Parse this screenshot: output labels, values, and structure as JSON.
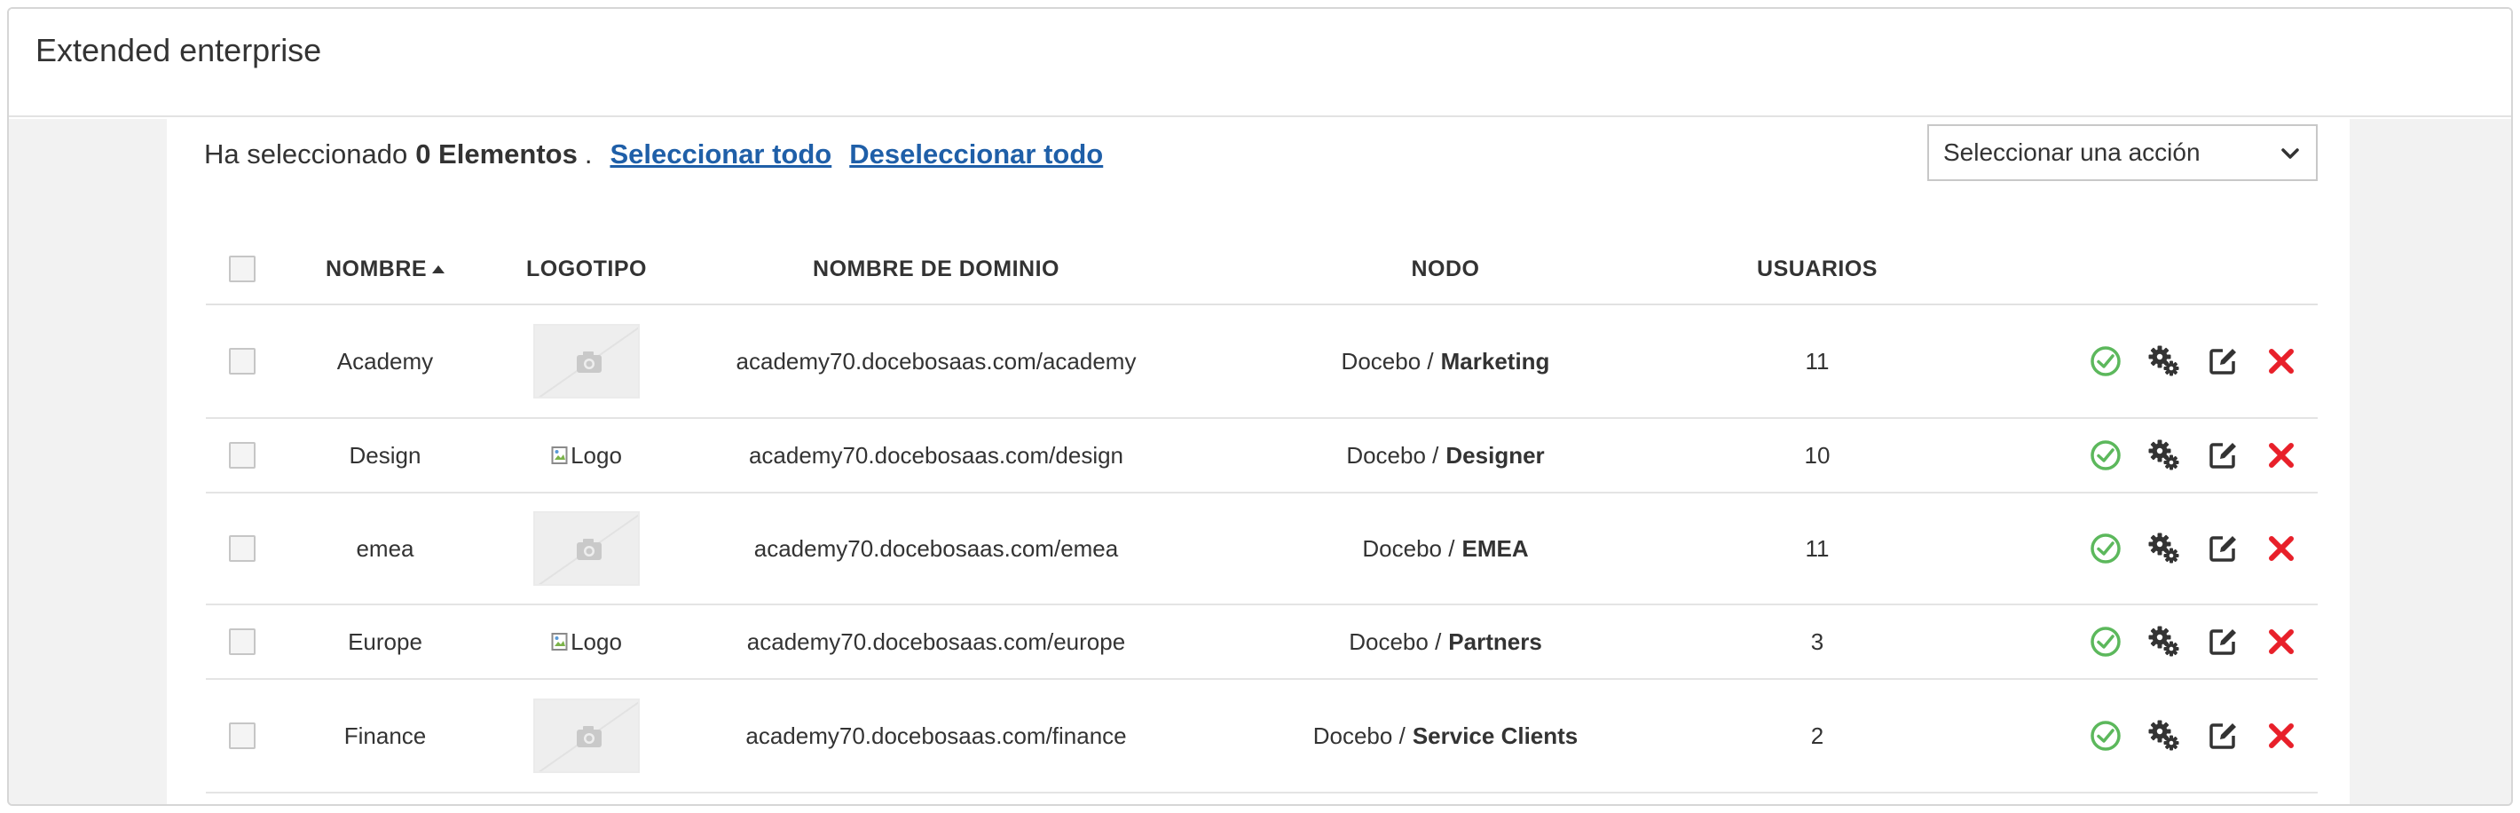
{
  "page": {
    "title": "Extended enterprise"
  },
  "selection": {
    "prefix": "Ha seleccionado",
    "count": "0 Elementos",
    "dot": ".",
    "select_all": "Seleccionar todo",
    "deselect_all": "Deseleccionar todo"
  },
  "action_select": {
    "value": "Seleccionar una acción"
  },
  "table": {
    "headers": {
      "name": "NOMBRE",
      "logo": "LOGOTIPO",
      "domain": "NOMBRE DE DOMINIO",
      "node": "NODO",
      "users": "USUARIOS"
    },
    "sort": {
      "column": "name",
      "direction": "ascending"
    },
    "rows": [
      {
        "name": "Academy",
        "logo": {
          "type": "placeholder",
          "alt": ""
        },
        "domain": "academy70.docebosaas.com/academy",
        "node_root": "Docebo",
        "node_sep": "/",
        "node_leaf": "Marketing",
        "users": "11"
      },
      {
        "name": "Design",
        "logo": {
          "type": "broken",
          "alt": "Logo"
        },
        "domain": "academy70.docebosaas.com/design",
        "node_root": "Docebo",
        "node_sep": "/",
        "node_leaf": "Designer",
        "users": "10"
      },
      {
        "name": "emea",
        "logo": {
          "type": "placeholder",
          "alt": ""
        },
        "domain": "academy70.docebosaas.com/emea",
        "node_root": "Docebo",
        "node_sep": "/",
        "node_leaf": "EMEA",
        "users": "11"
      },
      {
        "name": "Europe",
        "logo": {
          "type": "broken",
          "alt": "Logo"
        },
        "domain": "academy70.docebosaas.com/europe",
        "node_root": "Docebo",
        "node_sep": "/",
        "node_leaf": "Partners",
        "users": "3"
      },
      {
        "name": "Finance",
        "logo": {
          "type": "placeholder",
          "alt": ""
        },
        "domain": "academy70.docebosaas.com/finance",
        "node_root": "Docebo",
        "node_sep": "/",
        "node_leaf": "Service Clients",
        "users": "2"
      }
    ],
    "row_actions": [
      "check-circle-icon",
      "gears-icon",
      "edit-icon",
      "close-icon"
    ]
  },
  "colors": {
    "link": "#1f5fa8",
    "active_green": "#5cb85c",
    "delete_red": "#e8202a",
    "icon_dark": "#333333",
    "page_background": "#f2f2f2"
  }
}
